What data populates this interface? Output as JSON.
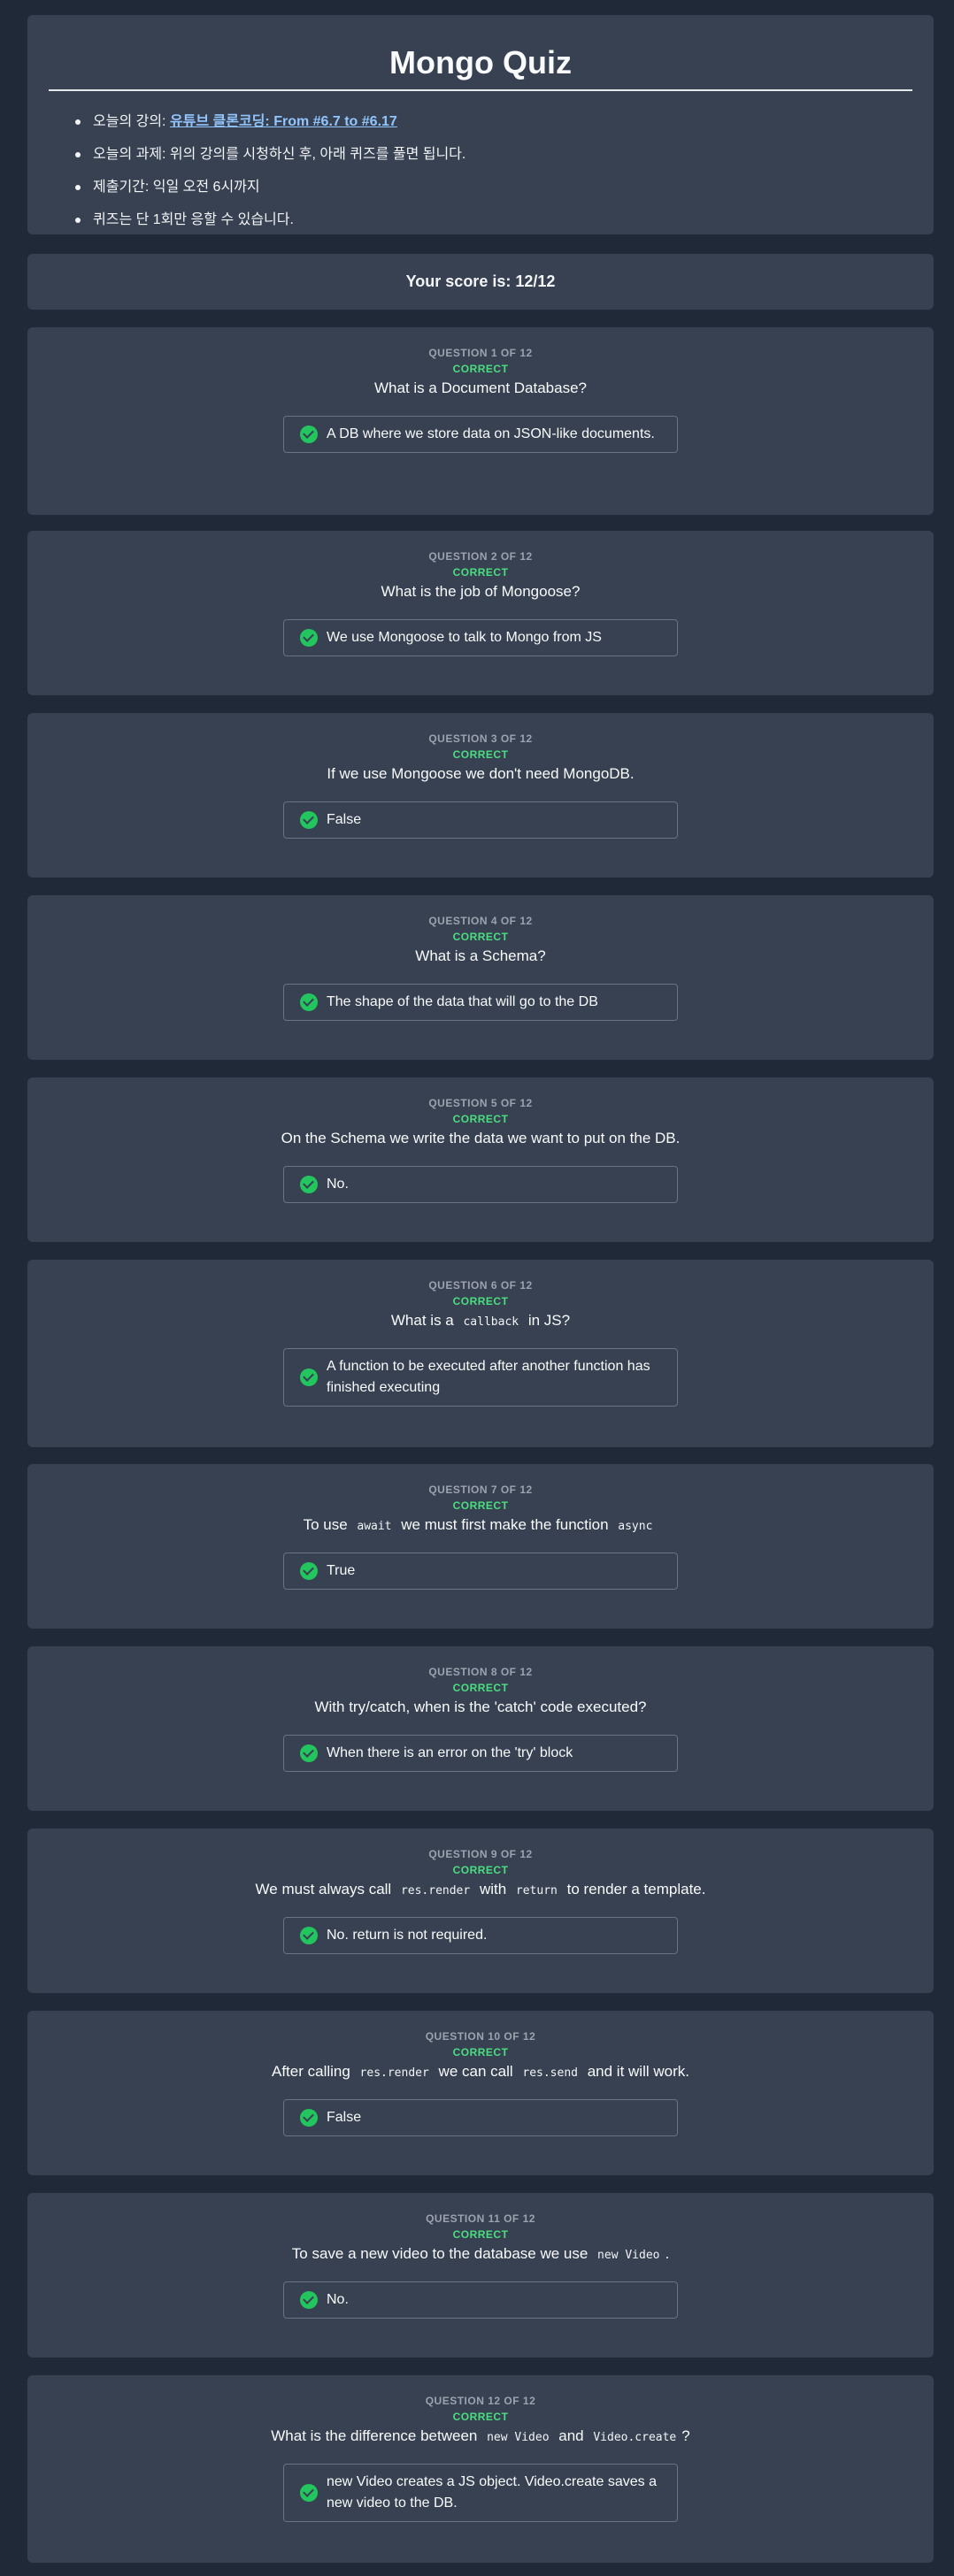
{
  "header": {
    "title": "Mongo Quiz",
    "items": [
      {
        "label": "오늘의 강의: ",
        "link": "유튜브 클론코딩: From #6.7 to #6.17"
      },
      {
        "label": "오늘의 과제: 위의 강의를 시청하신 후, 아래 퀴즈를 풀면 됩니다."
      },
      {
        "label": "제출기간: 익일 오전 6시까지"
      },
      {
        "label": "퀴즈는 단 1회만 응할 수 있습니다."
      }
    ]
  },
  "score": {
    "text": "Your score is: 12/12"
  },
  "colors": {
    "background": "#1f2937",
    "card": "#374151",
    "correct": "#22c55e",
    "link": "#93c5fd"
  },
  "questions": [
    {
      "number": "QUESTION 1 OF 12",
      "status": "CORRECT",
      "parts": [
        "What is a Document Database?"
      ],
      "answer": "A DB where we store data on JSON-like documents."
    },
    {
      "number": "QUESTION 2 OF 12",
      "status": "CORRECT",
      "parts": [
        "What is the job of Mongoose?"
      ],
      "answer": "We use Mongoose to talk to Mongo from JS"
    },
    {
      "number": "QUESTION 3 OF 12",
      "status": "CORRECT",
      "parts": [
        "If we use Mongoose we don't need MongoDB."
      ],
      "answer": "False"
    },
    {
      "number": "QUESTION 4 OF 12",
      "status": "CORRECT",
      "parts": [
        "What is a Schema?"
      ],
      "answer": "The shape of the data that will go to the DB"
    },
    {
      "number": "QUESTION 5 OF 12",
      "status": "CORRECT",
      "parts": [
        "On the Schema we write the data we want to put on the DB."
      ],
      "answer": "No."
    },
    {
      "number": "QUESTION 6 OF 12",
      "status": "CORRECT",
      "parts": [
        "What is a ",
        {
          "code": "callback"
        },
        " in JS?"
      ],
      "answer": "A function to be executed after another function has finished executing"
    },
    {
      "number": "QUESTION 7 OF 12",
      "status": "CORRECT",
      "parts": [
        "To use ",
        {
          "code": "await"
        },
        " we must first make the function ",
        {
          "code": "async"
        }
      ],
      "answer": "True"
    },
    {
      "number": "QUESTION 8 OF 12",
      "status": "CORRECT",
      "parts": [
        "With try/catch, when is the 'catch' code executed?"
      ],
      "answer": "When there is an error on the 'try' block"
    },
    {
      "number": "QUESTION 9 OF 12",
      "status": "CORRECT",
      "parts": [
        "We must always call ",
        {
          "code": "res.render"
        },
        " with ",
        {
          "code": "return"
        },
        " to render a template."
      ],
      "answer": "No. return is not required."
    },
    {
      "number": "QUESTION 10 OF 12",
      "status": "CORRECT",
      "parts": [
        "After calling ",
        {
          "code": "res.render"
        },
        " we can call ",
        {
          "code": "res.send"
        },
        " and it will work."
      ],
      "answer": "False"
    },
    {
      "number": "QUESTION 11 OF 12",
      "status": "CORRECT",
      "parts": [
        "To save a new video to the database we use ",
        {
          "code": "new Video"
        },
        "."
      ],
      "answer": "No."
    },
    {
      "number": "QUESTION 12 OF 12",
      "status": "CORRECT",
      "parts": [
        "What is the difference between ",
        {
          "code": "new Video"
        },
        " and ",
        {
          "code": "Video.create"
        },
        "?"
      ],
      "answer": "new Video creates a JS object. Video.create saves a new video to the DB."
    }
  ]
}
